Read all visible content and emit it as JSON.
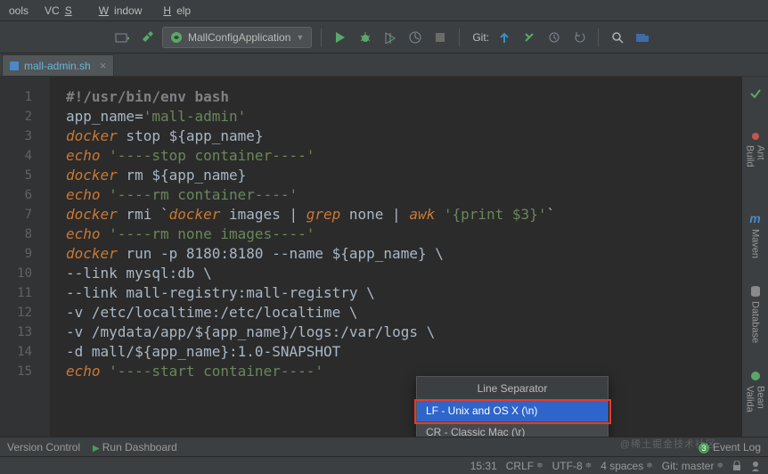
{
  "menu": {
    "tools": "ools",
    "vcs": "VCS",
    "window": "Window",
    "help": "Help",
    "u": {
      "vcs": "S",
      "window": "W",
      "help": "H"
    }
  },
  "toolbar": {
    "run_config": "MallConfigApplication",
    "git_label": "Git:"
  },
  "tab": {
    "name": "mall-admin.sh",
    "close": "×"
  },
  "code": {
    "lines": [
      {
        "n": 1,
        "segs": [
          {
            "c": "c-bold",
            "t": "#!/usr/bin/env bash"
          }
        ]
      },
      {
        "n": 2,
        "segs": [
          {
            "c": "c-text",
            "t": "app_name="
          },
          {
            "c": "c-str",
            "t": "'mall-admin'"
          }
        ]
      },
      {
        "n": 3,
        "segs": [
          {
            "c": "c-kw",
            "t": "docker"
          },
          {
            "c": "c-text",
            "t": " stop "
          },
          {
            "c": "c-var",
            "t": "${app_name}"
          }
        ]
      },
      {
        "n": 4,
        "segs": [
          {
            "c": "c-kw",
            "t": "echo"
          },
          {
            "c": "c-text",
            "t": " "
          },
          {
            "c": "c-str",
            "t": "'----stop container----'"
          }
        ]
      },
      {
        "n": 5,
        "segs": [
          {
            "c": "c-kw",
            "t": "docker"
          },
          {
            "c": "c-text",
            "t": " rm "
          },
          {
            "c": "c-var",
            "t": "${app_name}"
          }
        ]
      },
      {
        "n": 6,
        "segs": [
          {
            "c": "c-kw",
            "t": "echo"
          },
          {
            "c": "c-text",
            "t": " "
          },
          {
            "c": "c-str",
            "t": "'----rm container----'"
          }
        ]
      },
      {
        "n": 7,
        "segs": [
          {
            "c": "c-kw",
            "t": "docker"
          },
          {
            "c": "c-text",
            "t": " rmi `"
          },
          {
            "c": "c-kw",
            "t": "docker"
          },
          {
            "c": "c-text",
            "t": " images | "
          },
          {
            "c": "c-kw",
            "t": "grep"
          },
          {
            "c": "c-text",
            "t": " none | "
          },
          {
            "c": "c-kw",
            "t": "awk"
          },
          {
            "c": "c-text",
            "t": " "
          },
          {
            "c": "c-str",
            "t": "'{print $3}'"
          },
          {
            "c": "c-text",
            "t": "`"
          }
        ]
      },
      {
        "n": 8,
        "segs": [
          {
            "c": "c-kw",
            "t": "echo"
          },
          {
            "c": "c-text",
            "t": " "
          },
          {
            "c": "c-str",
            "t": "'----rm none images----'"
          }
        ]
      },
      {
        "n": 9,
        "segs": [
          {
            "c": "c-kw",
            "t": "docker"
          },
          {
            "c": "c-text",
            "t": " run -p 8180:8180 --name "
          },
          {
            "c": "c-var",
            "t": "${app_name}"
          },
          {
            "c": "c-text",
            "t": " \\"
          }
        ]
      },
      {
        "n": 10,
        "segs": [
          {
            "c": "c-text",
            "t": "--link mysql:db \\"
          }
        ]
      },
      {
        "n": 11,
        "segs": [
          {
            "c": "c-text",
            "t": "--link mall-registry:mall-registry \\"
          }
        ]
      },
      {
        "n": 12,
        "segs": [
          {
            "c": "c-text",
            "t": "-v /etc/localtime:/etc/localtime \\"
          }
        ]
      },
      {
        "n": 13,
        "segs": [
          {
            "c": "c-text",
            "t": "-v /mydata/app/"
          },
          {
            "c": "c-var",
            "t": "${app_name}"
          },
          {
            "c": "c-text",
            "t": "/logs:/var/logs \\"
          }
        ]
      },
      {
        "n": 14,
        "segs": [
          {
            "c": "c-text",
            "t": "-d mall/"
          },
          {
            "c": "c-var",
            "t": "${app_name}"
          },
          {
            "c": "c-text",
            "t": ":1.0-SNAPSHOT"
          }
        ]
      },
      {
        "n": 15,
        "segs": [
          {
            "c": "c-kw",
            "t": "echo"
          },
          {
            "c": "c-text",
            "t": " "
          },
          {
            "c": "c-str",
            "t": "'----start container----'"
          }
        ]
      }
    ]
  },
  "rail": {
    "ant": "Ant Build",
    "maven": "Maven",
    "database": "Database",
    "bean": "Bean Valida",
    "maven_m": "m"
  },
  "popup": {
    "title": "Line Separator",
    "item1": "LF - Unix and OS X (\\n)",
    "item2": "CR - Classic Mac (\\r)"
  },
  "bottom": {
    "vcs": "Version Control",
    "run_dash": "Run Dashboard",
    "event_log": "Event Log",
    "event_badge": "3"
  },
  "status": {
    "pos": "15:31",
    "crlf": "CRLF",
    "encoding": "UTF-8",
    "indent": "4 spaces",
    "git_branch": "Git: master"
  },
  "watermark": "@稀土掘金技术社区"
}
